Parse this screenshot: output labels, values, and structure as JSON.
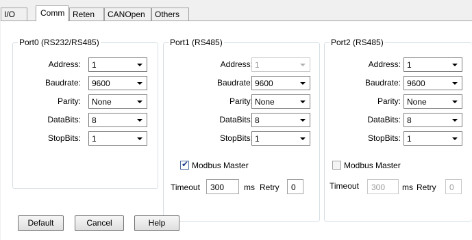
{
  "tabs": [
    {
      "label": "I/O"
    },
    {
      "label": "Comm"
    },
    {
      "label": "Reten"
    },
    {
      "label": "CANOpen"
    },
    {
      "label": "Others"
    }
  ],
  "active_tab": "Comm",
  "labels": {
    "address": "Address:",
    "baudrate": "Baudrate:",
    "parity": "Parity:",
    "databits": "DataBits:",
    "stopbits": "StopBits:",
    "modbus_master": "Modbus Master",
    "timeout": "Timeout",
    "ms": "ms",
    "retry": "Retry"
  },
  "port0": {
    "title": "Port0 (RS232/RS485)",
    "address": "1",
    "baudrate": "9600",
    "parity": "None",
    "databits": "8",
    "stopbits": "1"
  },
  "port1": {
    "title": "Port1 (RS485)",
    "address": "1",
    "baudrate": "9600",
    "parity": "None",
    "databits": "8",
    "stopbits": "1",
    "modbus_master": true,
    "timeout": "300",
    "retry": "0"
  },
  "port2": {
    "title": "Port2 (RS485)",
    "address": "1",
    "baudrate": "9600",
    "parity": "None",
    "databits": "8",
    "stopbits": "1",
    "modbus_master": false,
    "timeout": "300",
    "retry": "0"
  },
  "buttons": {
    "default": "Default",
    "cancel": "Cancel",
    "help": "Help"
  }
}
